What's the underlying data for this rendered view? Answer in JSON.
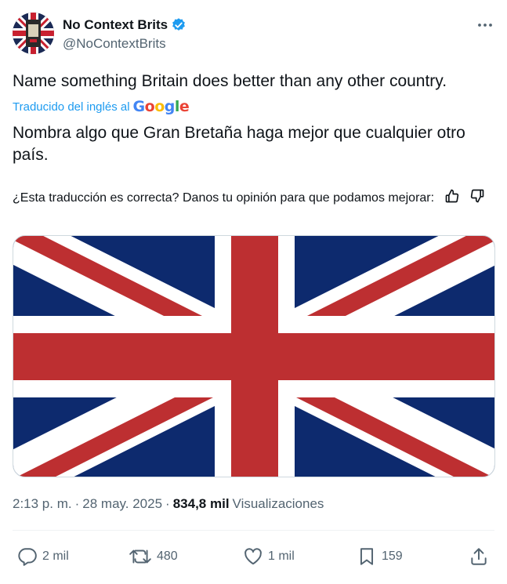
{
  "author": {
    "display_name": "No Context Brits",
    "handle": "@NoContextBrits"
  },
  "tweet": {
    "text": "Name something Britain does better than any other country.",
    "translated_label": "Traducido del inglés al",
    "translation_provider": "Google",
    "translation": "Nombra algo que Gran Bretaña haga mejor que cualquier otro país.",
    "feedback_prompt": "¿Esta traducción es correcta? Danos tu opinión para que podamos mejorar:"
  },
  "media": {
    "colors": {
      "blue": "#0d2a6e",
      "red": "#bd2f31",
      "white": "#ffffff"
    }
  },
  "meta": {
    "time": "2:13 p. m.",
    "separator": "·",
    "date": "28 may. 2025",
    "views_count": "834,8 mil",
    "views_label": "Visualizaciones"
  },
  "actions": {
    "replies": "2 mil",
    "retweets": "480",
    "likes": "1 mil",
    "bookmarks": "159"
  },
  "colors": {
    "verified": "#1d9bf0",
    "link": "#1d9bf0",
    "secondary_text": "#536471"
  },
  "icons": [
    "verified-badge-icon",
    "more-icon",
    "thumbs-up-icon",
    "thumbs-down-icon",
    "reply-icon",
    "retweet-icon",
    "like-icon",
    "bookmark-icon",
    "share-icon"
  ]
}
